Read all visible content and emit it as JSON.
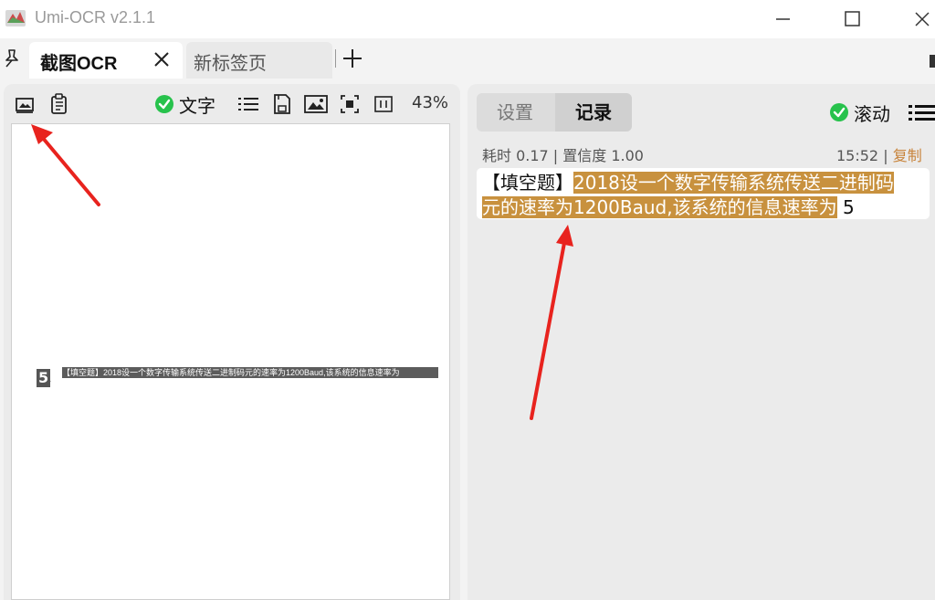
{
  "window": {
    "title": "Umi-OCR v2.1.1"
  },
  "tabs": {
    "active_label": "截图OCR",
    "inactive_label": "新标签页"
  },
  "left_toolbar": {
    "text_toggle_label": "文字",
    "zoom": "43%"
  },
  "preview": {
    "digit": "5",
    "digit_small": "·",
    "line_text": "【填空题】2018设一个数字传输系统传送二进制码元的速率为1200Baud,该系统的信息速率为"
  },
  "right_panel": {
    "tab_settings": "设置",
    "tab_records": "记录",
    "scroll_label": "滚动"
  },
  "record": {
    "meta_left": "耗时 0.17 | 置信度 1.00",
    "time": "15:52",
    "separator": "|",
    "copy_label": "复制",
    "prefix": "【填空题】",
    "highlight_line1": "2018设一个数字传输系统传送二进制码",
    "highlight_line2": "元的速率为1200Baud,该系统的信息速率为",
    "suffix": "5"
  },
  "colors": {
    "highlight": "#c8913e",
    "check": "#27c24c",
    "annotation_arrow": "#e8231e",
    "copy_link": "#c8833a"
  }
}
